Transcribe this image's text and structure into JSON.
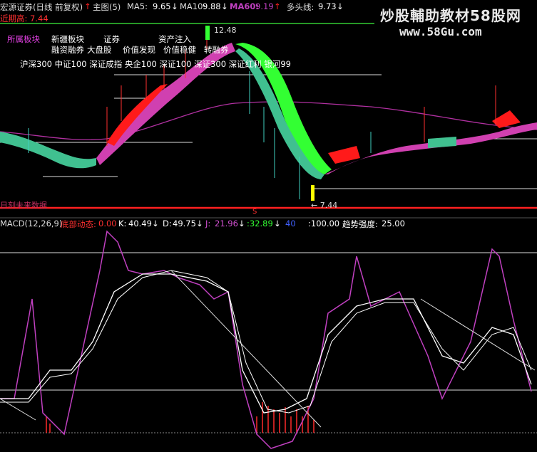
{
  "header": {
    "title": "宏源证券(日线 前复权)",
    "main_label": "主图(5)",
    "ma5_label": "MA5:",
    "ma5_value": "9.65",
    "ma10_label": "MA10:",
    "ma10_value": "9.88",
    "ma60_label": "MA60:",
    "ma60_value": "9.19",
    "duotou_label": "多头线:",
    "duotou_value": "9.73",
    "subline": "近期高: 7.44"
  },
  "watermark": {
    "text": "炒股輔助教材58股网",
    "url": "www.58Gu.com"
  },
  "blocks": {
    "label": "所属板块",
    "row1": [
      "新疆板块",
      "证券",
      "资产注入"
    ],
    "row2": [
      "融资融券",
      "大盘股",
      "价值发现",
      "价值稳健",
      "转融券"
    ],
    "row3": "沪深300 中证100 深证成指 央企100 深证100 深证300 深证红利 银河99"
  },
  "price_labels": {
    "high": "12.48",
    "low": "← 7.44",
    "bottom_left": "日刻未来数据",
    "marker_s": "S"
  },
  "indicator": {
    "macd_label": "MACD(12,26,9)",
    "bottom_label": "底部动态:",
    "bottom_value": "0.00",
    "k_label": "K:",
    "k_value": "40.49",
    "d_label": "D:",
    "d_value": "49.75",
    "j_label": "J:",
    "j_value": "21.96",
    "v1_value": "32.89",
    "v2_value": "40",
    "v3_value": ":100.00",
    "trend_label": "趋势强度:",
    "trend_value": "25.00"
  },
  "colors": {
    "red": "#ff2020",
    "green": "#33ff33",
    "teal": "#4ed8a8",
    "magenta": "#d040c0",
    "white": "#ffffff",
    "yellow": "#ffff00",
    "blue": "#4060ff",
    "cyan": "#40e0ff",
    "purple": "#c080ff"
  }
}
